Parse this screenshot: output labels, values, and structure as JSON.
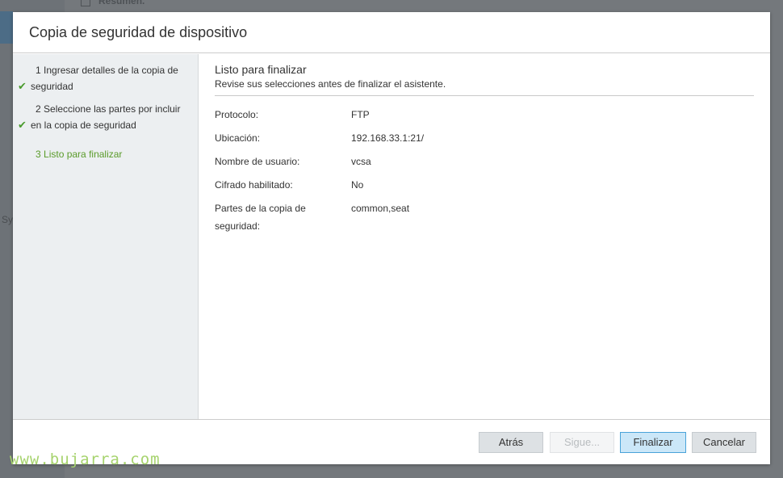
{
  "background": {
    "summary_label": "Resumen.",
    "left_text": "Sy"
  },
  "watermark": "www.bujarra.com",
  "dialog": {
    "title": "Copia de seguridad de dispositivo",
    "steps": [
      {
        "num": "1",
        "label": "Ingresar detalles de la copia de seguridad",
        "completed": true
      },
      {
        "num": "2",
        "label": "Seleccione las partes por incluir en la copia de seguridad",
        "completed": true
      },
      {
        "num": "3",
        "label": "Listo para finalizar",
        "completed": false,
        "active": true
      }
    ],
    "content": {
      "title": "Listo para finalizar",
      "subtitle": "Revise sus selecciones antes de finalizar el asistente.",
      "fields": [
        {
          "label": "Protocolo:",
          "value": "FTP"
        },
        {
          "label": "Ubicación:",
          "value": "192.168.33.1:21/"
        },
        {
          "label": "Nombre de usuario:",
          "value": "vcsa"
        },
        {
          "label": "Cifrado habilitado:",
          "value": "No"
        },
        {
          "label": "Partes de la copia de seguridad:",
          "value": "common,seat"
        }
      ]
    },
    "buttons": {
      "back": "Atrás",
      "next": "Sigue...",
      "finish": "Finalizar",
      "cancel": "Cancelar"
    }
  },
  "colors": {
    "accent_green": "#5a9b2a",
    "primary_button_border": "#49a3d9",
    "primary_button_bg": "#cbe7f8"
  }
}
